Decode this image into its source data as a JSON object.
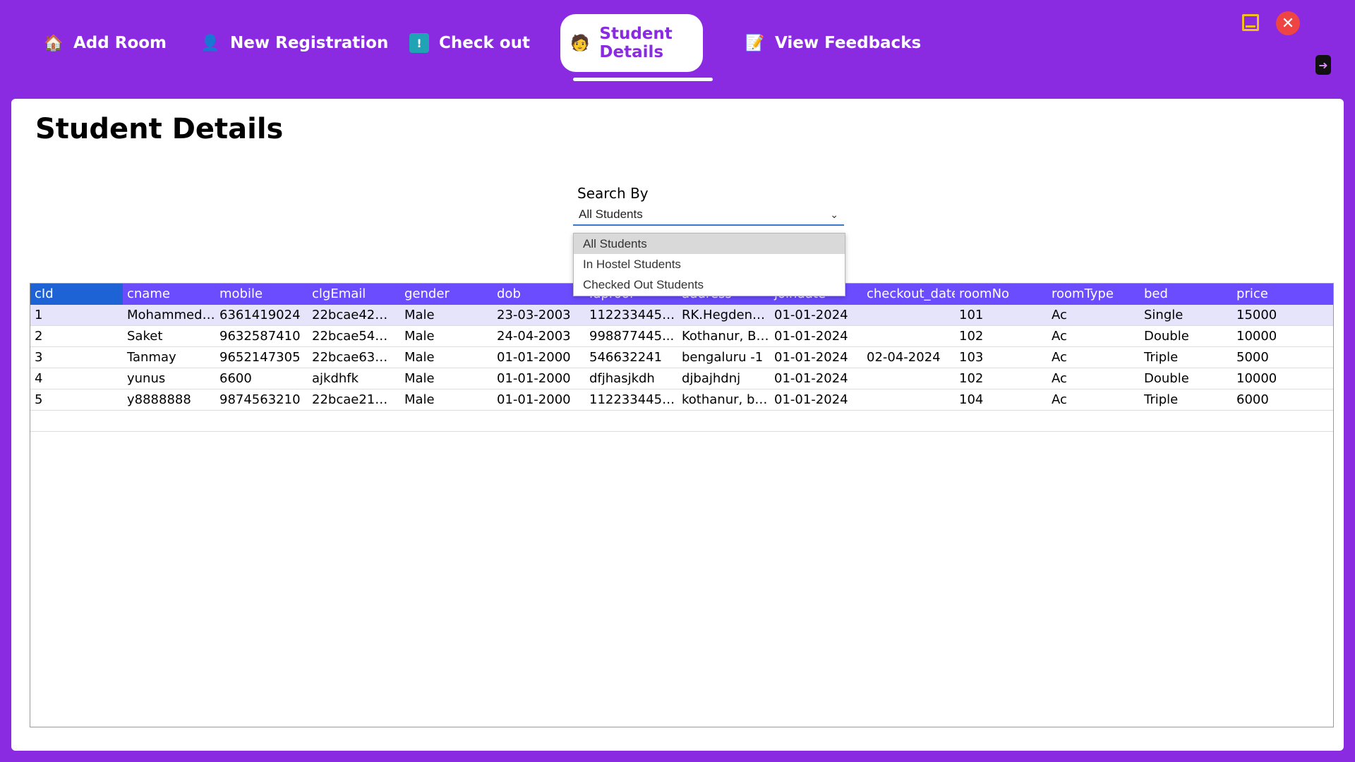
{
  "nav": {
    "tabs": [
      {
        "label": "Add Room",
        "icon": "room-icon"
      },
      {
        "label": "New Registration",
        "icon": "user-add-icon"
      },
      {
        "label": "Check out",
        "icon": "checkout-icon"
      },
      {
        "label": "Student Details",
        "icon": "student-info-icon",
        "active": true
      },
      {
        "label": "View Feedbacks",
        "icon": "feedback-icon"
      }
    ]
  },
  "window": {
    "minimize_icon": "minimize-icon",
    "close_label": "✕",
    "logout_label": "➜"
  },
  "page": {
    "title": "Student Details"
  },
  "search": {
    "label": "Search By",
    "selected": "All Students",
    "options": [
      "All Students",
      "In Hostel Students",
      "Checked Out Students"
    ]
  },
  "table": {
    "columns": [
      "cId",
      "cname",
      "mobile",
      "clgEmail",
      "gender",
      "dob",
      "idproof",
      "address",
      "joindate",
      "checkout_date",
      "roomNo",
      "roomType",
      "bed",
      "price"
    ],
    "rows": [
      [
        "1",
        "Mohammed ...",
        "6361419024",
        "22bcae42@k...",
        "Male",
        "23-03-2003",
        "1122334455...",
        "RK.Hegdena...",
        "01-01-2024",
        "",
        "101",
        "Ac",
        "Single",
        "15000"
      ],
      [
        "2",
        "Saket",
        "9632587410",
        "22bcae54@k...",
        "Male",
        "24-04-2003",
        "998877445...",
        "Kothanur, Be...",
        "01-01-2024",
        "",
        "102",
        "Ac",
        "Double",
        "10000"
      ],
      [
        "3",
        "Tanmay",
        "9652147305",
        "22bcae63@k...",
        "Male",
        "01-01-2000",
        "546632241",
        "bengaluru -1",
        "01-01-2024",
        "02-04-2024",
        "103",
        "Ac",
        "Triple",
        "5000"
      ],
      [
        "4",
        "yunus",
        "6600",
        "ajkdhfk",
        "Male",
        "01-01-2000",
        "dfjhasjkdh",
        "djbajhdnj",
        "01-01-2024",
        "",
        "102",
        "Ac",
        "Double",
        "10000"
      ],
      [
        "5",
        "y8888888",
        "9874563210",
        "22bcae21@k...",
        "Male",
        "01-01-2000",
        "1122334455...",
        "kothanur, be...",
        "01-01-2024",
        "",
        "104",
        "Ac",
        "Triple",
        "6000"
      ]
    ]
  },
  "colors": {
    "brand": "#8a2be2",
    "header_bg": "#6b4dff",
    "selected_header": "#1e63d6"
  }
}
